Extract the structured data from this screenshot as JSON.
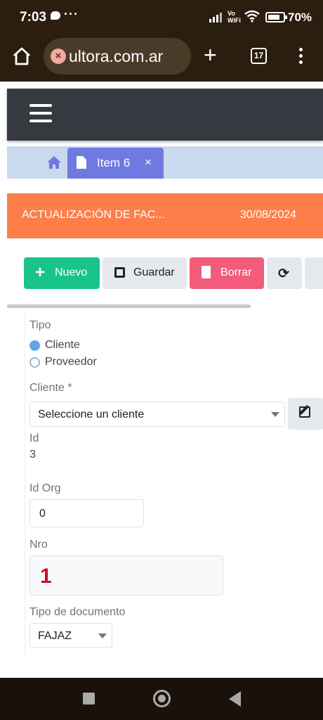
{
  "status_bar": {
    "time": "7:03",
    "dots": "···",
    "vo": "Vo",
    "wifi_label": "WiFi",
    "battery": "70%"
  },
  "browser": {
    "url": "ultora.com.ar",
    "tab_count": "17",
    "icons": [
      "home-icon",
      "close-icon",
      "plus-icon",
      "tabs-icon",
      "more-vert-icon"
    ]
  },
  "app": {
    "tab": {
      "label": "Item 6",
      "close": "×"
    },
    "title_bar": {
      "title": "ACTUALIZACIÓN DE FAC...",
      "date": "30/08/2024",
      "color": "#fd7e49"
    },
    "toolbar": {
      "nuevo": "Nuevo",
      "guardar": "Guardar",
      "borrar": "Borrar",
      "colors": {
        "nuevo": "#19c48a",
        "borrar": "#f25b7a"
      }
    },
    "form": {
      "tipo_label": "Tipo",
      "tipo_options": [
        "Cliente",
        "Proveedor"
      ],
      "tipo_selected": "Cliente",
      "cliente_label": "Cliente *",
      "cliente_placeholder": "Seleccione un cliente",
      "id_label": "Id",
      "id_value": "3",
      "id_org_label": "Id Org",
      "id_org_value": "0",
      "nro_label": "Nro",
      "nro_value": "1",
      "tipo_doc_label": "Tipo de documento",
      "tipo_doc_value": "FAJAZ"
    }
  }
}
